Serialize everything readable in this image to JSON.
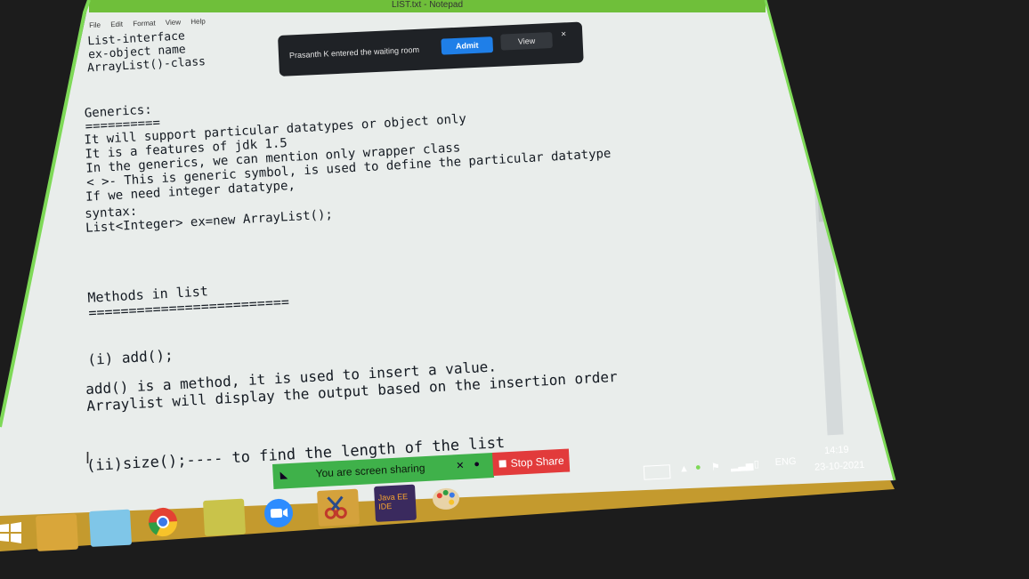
{
  "window": {
    "title": "LIST.txt - Notepad"
  },
  "menu": [
    "File",
    "Edit",
    "Format",
    "View",
    "Help"
  ],
  "editor_lines": [
    "List-interface",
    "ex-object name",
    "ArrayList()-class",
    "Generics:",
    "==========",
    "It will support particular datatypes or object only",
    "It is a features of jdk 1.5",
    "In the generics, we can mention only wrapper class",
    "< >- This is generic symbol, is used to define the particular datatype",
    "If we need integer datatype,",
    "syntax:",
    "List<Integer> ex=new ArrayList();",
    "Methods in list",
    "=========================",
    "(i) add();",
    "add() is a method, it is used to insert a value.",
    "Arraylist will display the output based on the insertion order",
    "(ii)size();---- to find the length of the list"
  ],
  "notification": {
    "message": "Prasanth K entered the waiting room",
    "admit_label": "Admit",
    "view_label": "View",
    "close_label": "×"
  },
  "share_bar": {
    "text": "You are screen sharing",
    "stop_label": "Stop Share"
  },
  "taskbar": {
    "apps": [
      "file-explorer",
      "notepad",
      "chrome",
      "sticky",
      "zoom",
      "snipping-tool",
      "java-ee-ide",
      "paint"
    ],
    "ide_label": "Java EE IDE",
    "lang": "ENG",
    "time": "14:19",
    "date": "23-10-2021"
  },
  "colors": {
    "accent_green": "#7ed957",
    "screen_bg": "#e9edeb",
    "admit_blue": "#1f7fe8",
    "stop_red": "#e23b3b"
  }
}
